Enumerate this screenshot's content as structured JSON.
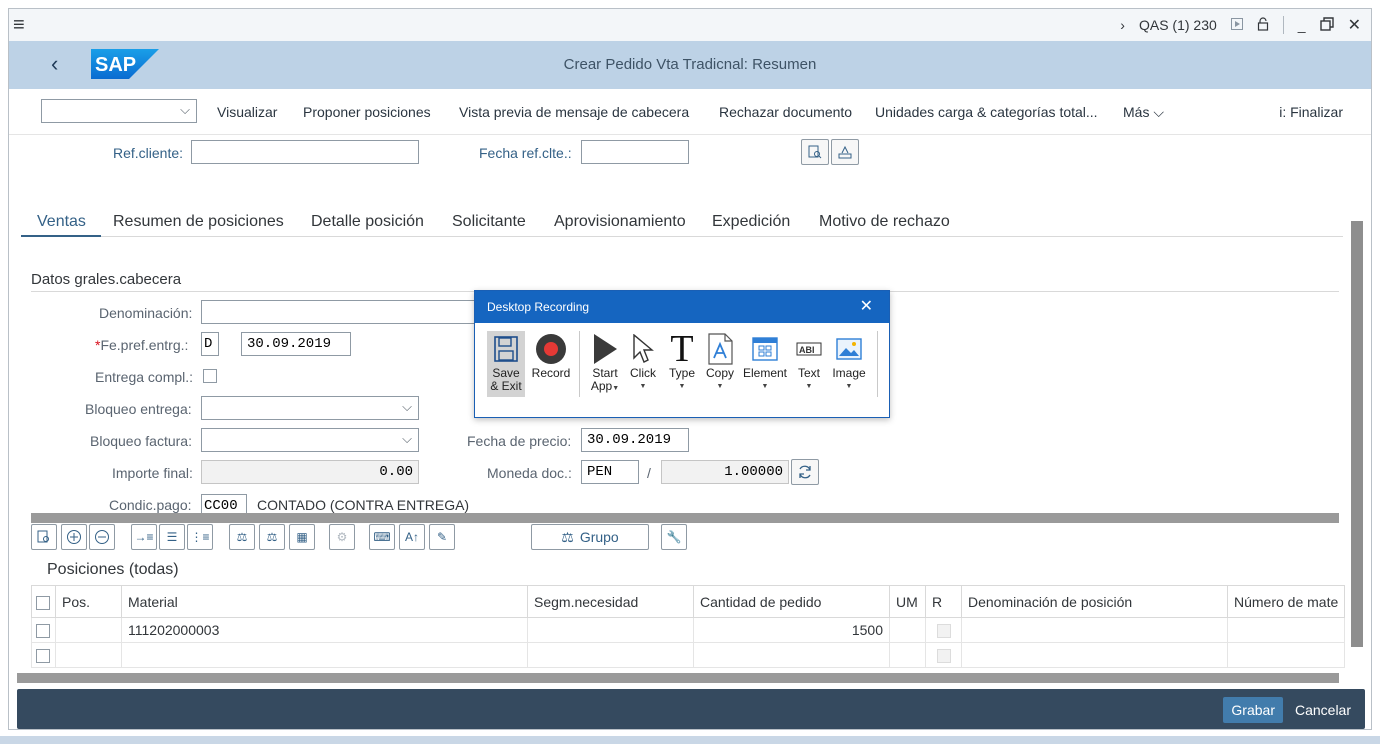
{
  "titlebar": {
    "menu_icon": "hamburger-icon",
    "system_label": "QAS (1) 230",
    "icons": [
      "chevron-right-icon",
      "play-icon",
      "lock-icon",
      "minimize-icon",
      "restore-icon",
      "close-icon"
    ]
  },
  "header": {
    "brand": "SAP",
    "title": "Crear Pedido Vta Tradicnal: Resumen"
  },
  "toolbar": {
    "dropdown_value": "",
    "items": [
      "Visualizar",
      "Proponer posiciones",
      "Vista previa de mensaje de cabecera",
      "Rechazar documento",
      "Unidades carga & categorías total...",
      "Más"
    ],
    "exit": "i: Finalizar"
  },
  "form_top": {
    "ref_cliente_label": "Ref.cliente:",
    "ref_cliente_value": "",
    "fecha_ref_label": "Fecha ref.clte.:",
    "fecha_ref_value": ""
  },
  "tabs": [
    "Ventas",
    "Resumen de posiciones",
    "Detalle posición",
    "Solicitante",
    "Aprovisionamiento",
    "Expedición",
    "Motivo de rechazo"
  ],
  "section": {
    "title": "Datos grales.cabecera",
    "denominacion_label": "Denominación:",
    "denominacion_value": "",
    "fe_pref_req": "*",
    "fe_pref_label": "Fe.pref.entrg.:",
    "fe_pref_type": "D",
    "fe_pref_date": "30.09.2019",
    "entrega_compl_label": "Entrega compl.:",
    "bloqueo_entrega_label": "Bloqueo entrega:",
    "bloqueo_factura_label": "Bloqueo factura:",
    "importe_final_label": "Importe final:",
    "importe_final_value": "0.00",
    "condic_pago_label": "Condic.pago:",
    "condic_pago_value": "CC00",
    "condic_pago_text": "CONTADO (CONTRA ENTREGA)",
    "fecha_precio_label": "Fecha de precio:",
    "fecha_precio_value": "30.09.2019",
    "moneda_label": "Moneda doc.:",
    "moneda_value": "PEN",
    "moneda_sep": "/",
    "tasa_value": "1.00000"
  },
  "grid": {
    "title": "Posiciones (todas)",
    "group_button": "Grupo",
    "columns": [
      "Pos.",
      "Material",
      "Segm.necesidad",
      "Cantidad de pedido",
      "UM",
      "R",
      "Denominación de posición",
      "Número de mate"
    ],
    "rows": [
      {
        "pos": "",
        "material": "111202000003",
        "segm": "",
        "cantidad": "1500",
        "um": "",
        "denominacion": "",
        "numero": ""
      },
      {
        "pos": "",
        "material": "",
        "segm": "",
        "cantidad": "",
        "um": "",
        "denominacion": "",
        "numero": ""
      }
    ]
  },
  "footer": {
    "save": "Grabar",
    "cancel": "Cancelar"
  },
  "recorder": {
    "title": "Desktop Recording",
    "buttons": [
      {
        "line1": "Save",
        "line2": "& Exit",
        "icon": "floppy-disk-icon"
      },
      {
        "line1": "Record",
        "line2": "",
        "icon": "record-icon"
      },
      {
        "line1": "Start",
        "line2": "App",
        "icon": "play-icon"
      },
      {
        "line1": "Click",
        "line2": "",
        "icon": "cursor-icon"
      },
      {
        "line1": "Type",
        "line2": "",
        "icon": "type-icon"
      },
      {
        "line1": "Copy",
        "line2": "",
        "icon": "copy-icon"
      },
      {
        "line1": "Element",
        "line2": "",
        "icon": "element-icon"
      },
      {
        "line1": "Text",
        "line2": "",
        "icon": "text-field-icon"
      },
      {
        "line1": "Image",
        "line2": "",
        "icon": "image-icon"
      }
    ]
  }
}
